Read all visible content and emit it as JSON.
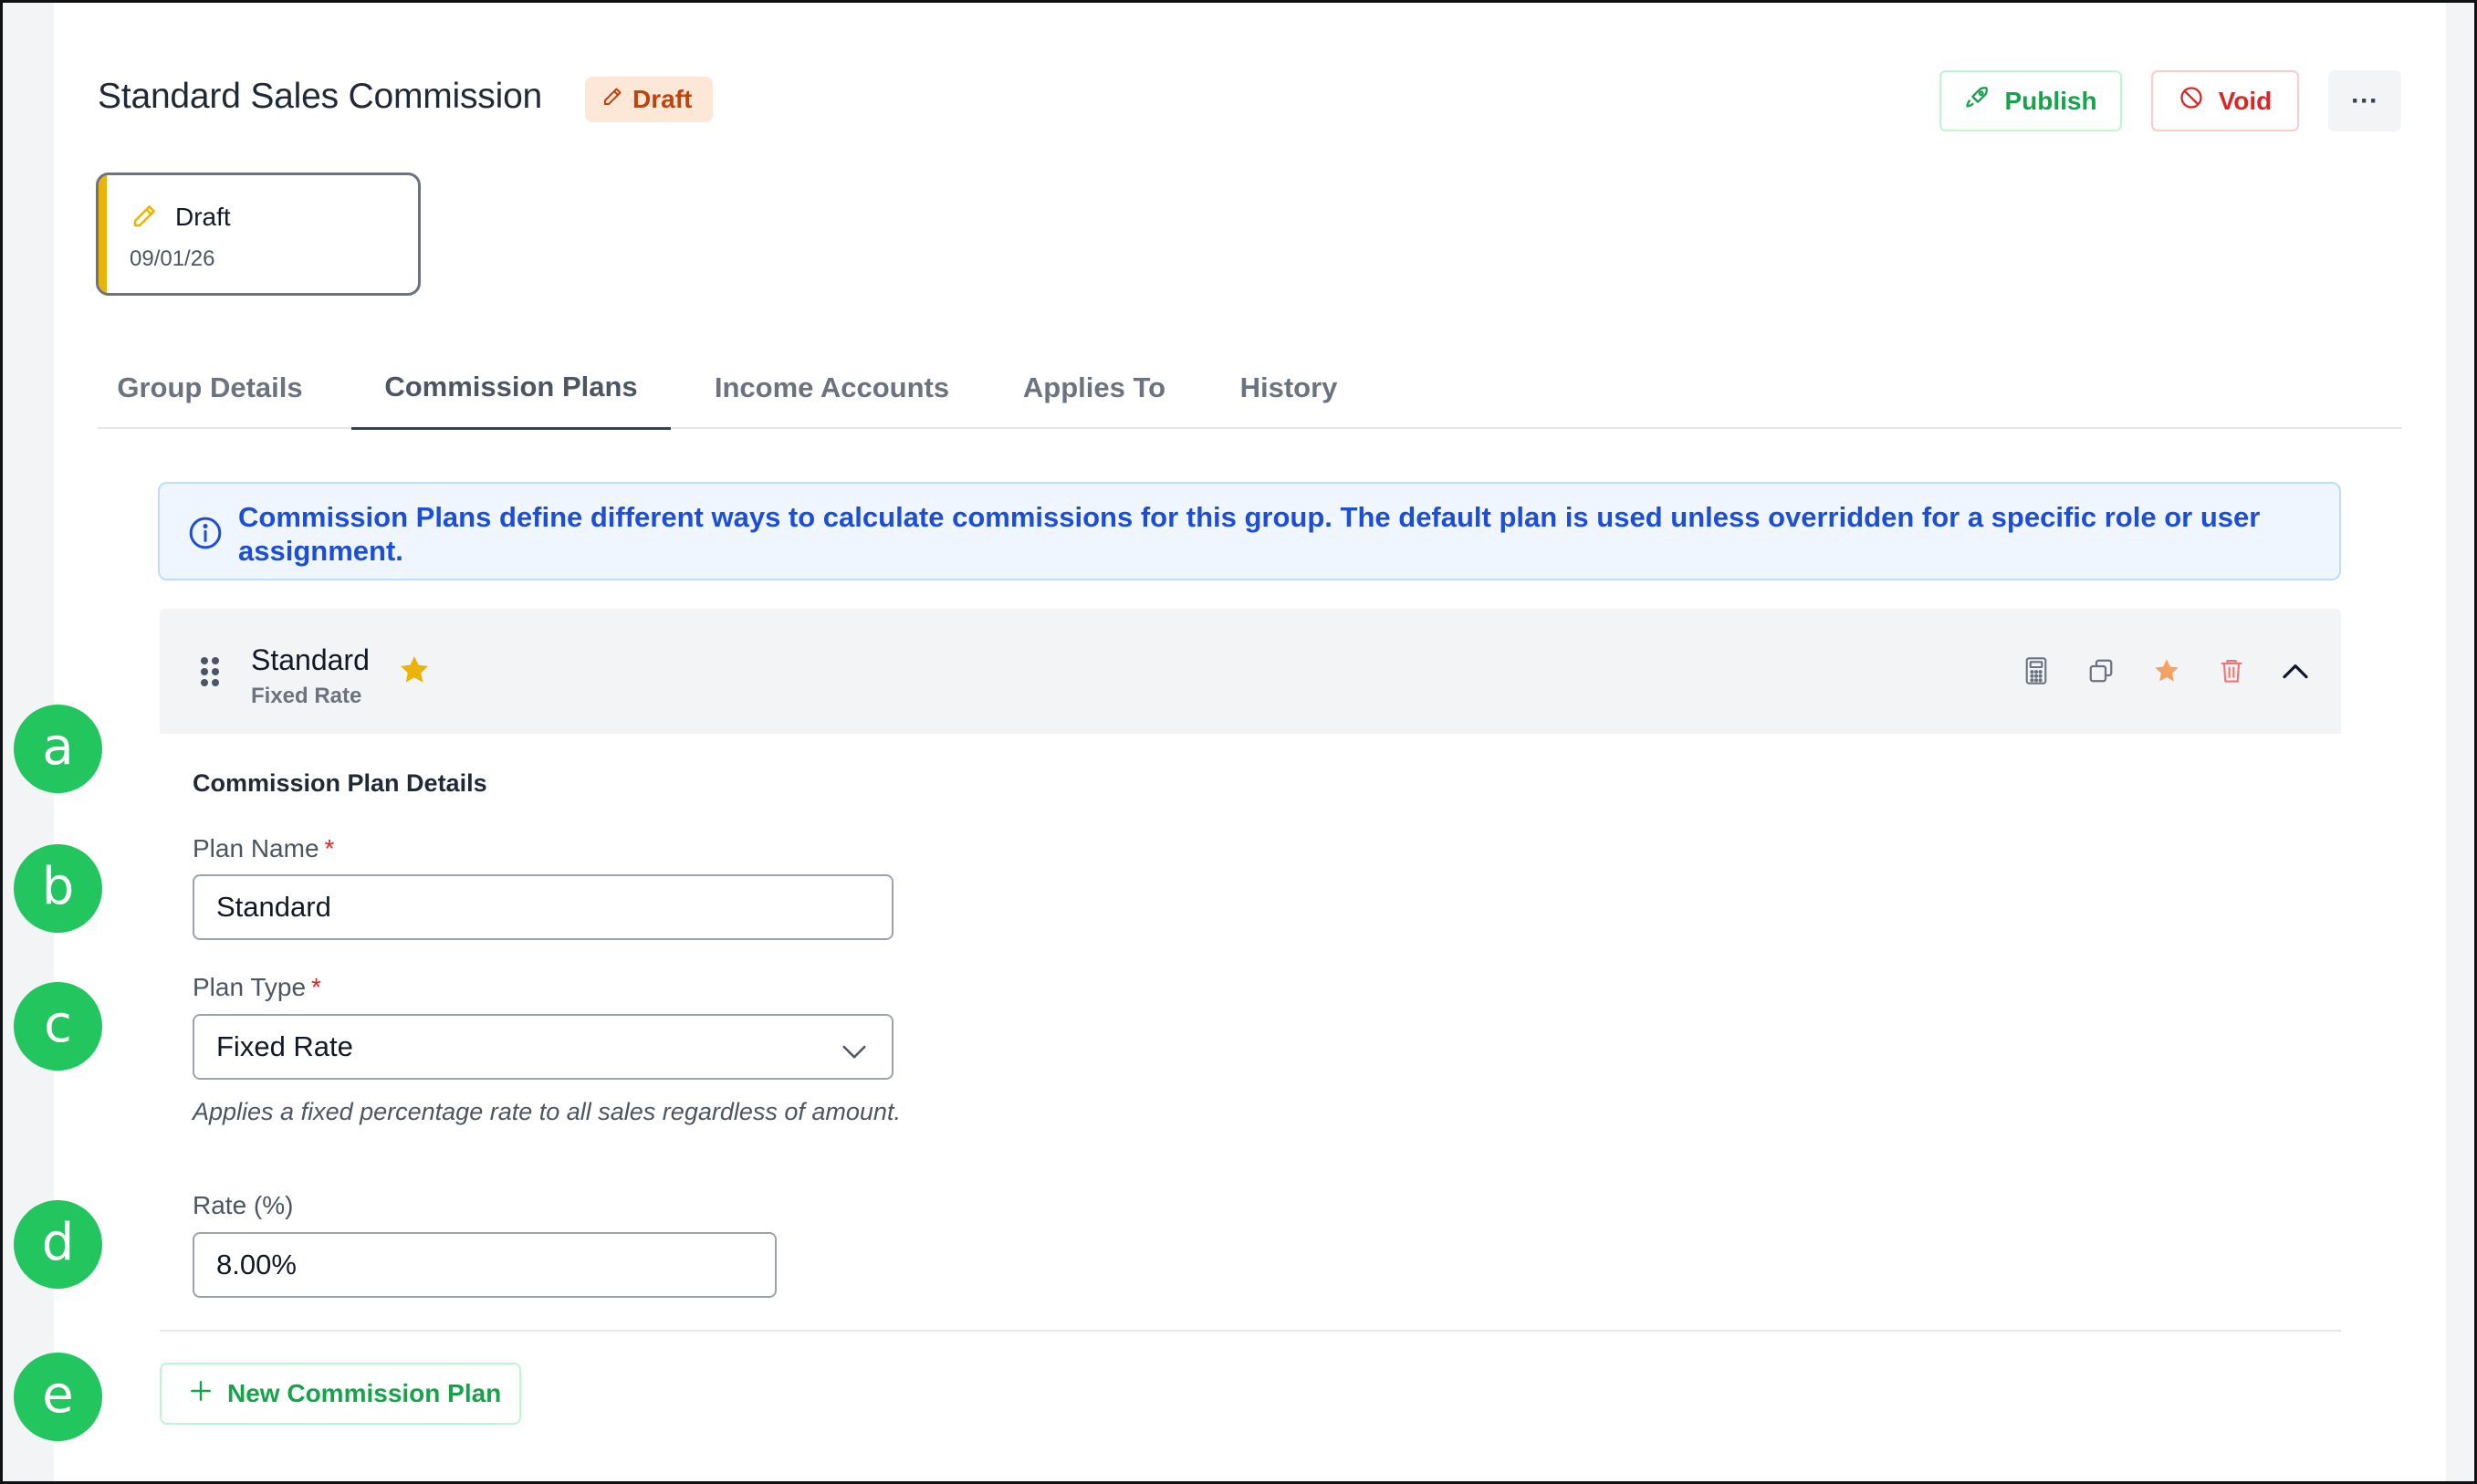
{
  "header": {
    "title": "Standard Sales Commission",
    "status_badge": "Draft",
    "publish_label": "Publish",
    "void_label": "Void",
    "more_label": "···"
  },
  "status_card": {
    "label": "Draft",
    "date": "09/01/26"
  },
  "tabs": [
    {
      "label": "Group Details",
      "active": false
    },
    {
      "label": "Commission Plans",
      "active": true
    },
    {
      "label": "Income Accounts",
      "active": false
    },
    {
      "label": "Applies To",
      "active": false
    },
    {
      "label": "History",
      "active": false
    }
  ],
  "info_banner": {
    "text": "Commission Plans define different ways to calculate commissions for this group. The default plan is used unless overridden for a specific role or user assignment."
  },
  "plan": {
    "name": "Standard",
    "type_subtitle": "Fixed Rate",
    "details_title": "Commission Plan Details",
    "name_label": "Plan Name",
    "name_value": "Standard",
    "type_label": "Plan Type",
    "type_value": "Fixed Rate",
    "type_help": "Applies a fixed percentage rate to all sales regardless of amount.",
    "rate_label": "Rate (%)",
    "rate_value": "8.00%",
    "required_mark": "*"
  },
  "new_plan_label": "New Commission Plan",
  "markers": [
    "a",
    "b",
    "c",
    "d",
    "e"
  ],
  "icons": {
    "badge": "pencil-icon",
    "publish": "rocket-icon",
    "void": "ban-icon",
    "info": "info-icon",
    "drag": "drag-handle-icon",
    "default": "star-icon",
    "actions": [
      "calculator-icon",
      "duplicate-icon",
      "star-icon",
      "trash-icon",
      "chevron-up-icon"
    ]
  },
  "colors": {
    "accent_green": "#16a34a",
    "danger_red": "#dc2626",
    "info_blue": "#1d4ed8",
    "draft_orange": "#c2410c",
    "star_yellow": "#eab308",
    "marker_green": "#22c55e"
  }
}
